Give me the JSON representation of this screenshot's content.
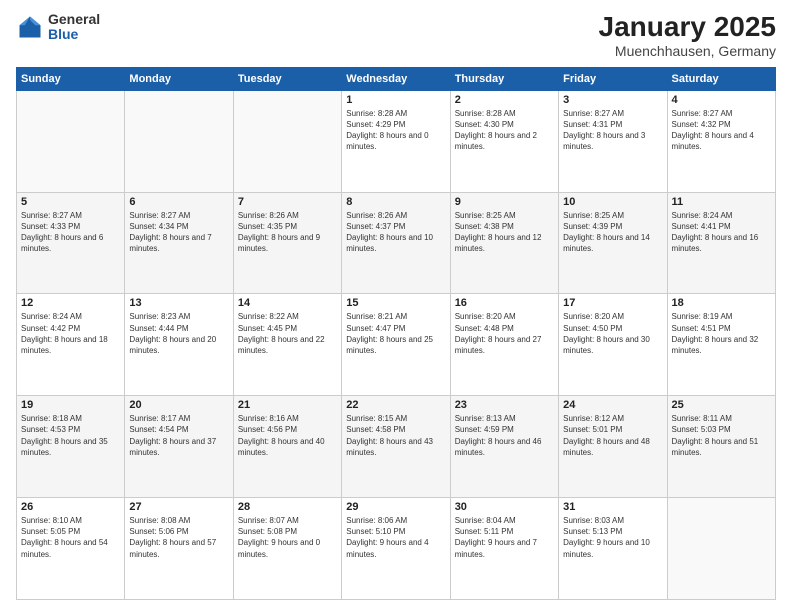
{
  "logo": {
    "general": "General",
    "blue": "Blue"
  },
  "title": "January 2025",
  "subtitle": "Muenchhausen, Germany",
  "days_of_week": [
    "Sunday",
    "Monday",
    "Tuesday",
    "Wednesday",
    "Thursday",
    "Friday",
    "Saturday"
  ],
  "weeks": [
    [
      {
        "day": "",
        "sunrise": "",
        "sunset": "",
        "daylight": ""
      },
      {
        "day": "",
        "sunrise": "",
        "sunset": "",
        "daylight": ""
      },
      {
        "day": "",
        "sunrise": "",
        "sunset": "",
        "daylight": ""
      },
      {
        "day": "1",
        "sunrise": "Sunrise: 8:28 AM",
        "sunset": "Sunset: 4:29 PM",
        "daylight": "Daylight: 8 hours and 0 minutes."
      },
      {
        "day": "2",
        "sunrise": "Sunrise: 8:28 AM",
        "sunset": "Sunset: 4:30 PM",
        "daylight": "Daylight: 8 hours and 2 minutes."
      },
      {
        "day": "3",
        "sunrise": "Sunrise: 8:27 AM",
        "sunset": "Sunset: 4:31 PM",
        "daylight": "Daylight: 8 hours and 3 minutes."
      },
      {
        "day": "4",
        "sunrise": "Sunrise: 8:27 AM",
        "sunset": "Sunset: 4:32 PM",
        "daylight": "Daylight: 8 hours and 4 minutes."
      }
    ],
    [
      {
        "day": "5",
        "sunrise": "Sunrise: 8:27 AM",
        "sunset": "Sunset: 4:33 PM",
        "daylight": "Daylight: 8 hours and 6 minutes."
      },
      {
        "day": "6",
        "sunrise": "Sunrise: 8:27 AM",
        "sunset": "Sunset: 4:34 PM",
        "daylight": "Daylight: 8 hours and 7 minutes."
      },
      {
        "day": "7",
        "sunrise": "Sunrise: 8:26 AM",
        "sunset": "Sunset: 4:35 PM",
        "daylight": "Daylight: 8 hours and 9 minutes."
      },
      {
        "day": "8",
        "sunrise": "Sunrise: 8:26 AM",
        "sunset": "Sunset: 4:37 PM",
        "daylight": "Daylight: 8 hours and 10 minutes."
      },
      {
        "day": "9",
        "sunrise": "Sunrise: 8:25 AM",
        "sunset": "Sunset: 4:38 PM",
        "daylight": "Daylight: 8 hours and 12 minutes."
      },
      {
        "day": "10",
        "sunrise": "Sunrise: 8:25 AM",
        "sunset": "Sunset: 4:39 PM",
        "daylight": "Daylight: 8 hours and 14 minutes."
      },
      {
        "day": "11",
        "sunrise": "Sunrise: 8:24 AM",
        "sunset": "Sunset: 4:41 PM",
        "daylight": "Daylight: 8 hours and 16 minutes."
      }
    ],
    [
      {
        "day": "12",
        "sunrise": "Sunrise: 8:24 AM",
        "sunset": "Sunset: 4:42 PM",
        "daylight": "Daylight: 8 hours and 18 minutes."
      },
      {
        "day": "13",
        "sunrise": "Sunrise: 8:23 AM",
        "sunset": "Sunset: 4:44 PM",
        "daylight": "Daylight: 8 hours and 20 minutes."
      },
      {
        "day": "14",
        "sunrise": "Sunrise: 8:22 AM",
        "sunset": "Sunset: 4:45 PM",
        "daylight": "Daylight: 8 hours and 22 minutes."
      },
      {
        "day": "15",
        "sunrise": "Sunrise: 8:21 AM",
        "sunset": "Sunset: 4:47 PM",
        "daylight": "Daylight: 8 hours and 25 minutes."
      },
      {
        "day": "16",
        "sunrise": "Sunrise: 8:20 AM",
        "sunset": "Sunset: 4:48 PM",
        "daylight": "Daylight: 8 hours and 27 minutes."
      },
      {
        "day": "17",
        "sunrise": "Sunrise: 8:20 AM",
        "sunset": "Sunset: 4:50 PM",
        "daylight": "Daylight: 8 hours and 30 minutes."
      },
      {
        "day": "18",
        "sunrise": "Sunrise: 8:19 AM",
        "sunset": "Sunset: 4:51 PM",
        "daylight": "Daylight: 8 hours and 32 minutes."
      }
    ],
    [
      {
        "day": "19",
        "sunrise": "Sunrise: 8:18 AM",
        "sunset": "Sunset: 4:53 PM",
        "daylight": "Daylight: 8 hours and 35 minutes."
      },
      {
        "day": "20",
        "sunrise": "Sunrise: 8:17 AM",
        "sunset": "Sunset: 4:54 PM",
        "daylight": "Daylight: 8 hours and 37 minutes."
      },
      {
        "day": "21",
        "sunrise": "Sunrise: 8:16 AM",
        "sunset": "Sunset: 4:56 PM",
        "daylight": "Daylight: 8 hours and 40 minutes."
      },
      {
        "day": "22",
        "sunrise": "Sunrise: 8:15 AM",
        "sunset": "Sunset: 4:58 PM",
        "daylight": "Daylight: 8 hours and 43 minutes."
      },
      {
        "day": "23",
        "sunrise": "Sunrise: 8:13 AM",
        "sunset": "Sunset: 4:59 PM",
        "daylight": "Daylight: 8 hours and 46 minutes."
      },
      {
        "day": "24",
        "sunrise": "Sunrise: 8:12 AM",
        "sunset": "Sunset: 5:01 PM",
        "daylight": "Daylight: 8 hours and 48 minutes."
      },
      {
        "day": "25",
        "sunrise": "Sunrise: 8:11 AM",
        "sunset": "Sunset: 5:03 PM",
        "daylight": "Daylight: 8 hours and 51 minutes."
      }
    ],
    [
      {
        "day": "26",
        "sunrise": "Sunrise: 8:10 AM",
        "sunset": "Sunset: 5:05 PM",
        "daylight": "Daylight: 8 hours and 54 minutes."
      },
      {
        "day": "27",
        "sunrise": "Sunrise: 8:08 AM",
        "sunset": "Sunset: 5:06 PM",
        "daylight": "Daylight: 8 hours and 57 minutes."
      },
      {
        "day": "28",
        "sunrise": "Sunrise: 8:07 AM",
        "sunset": "Sunset: 5:08 PM",
        "daylight": "Daylight: 9 hours and 0 minutes."
      },
      {
        "day": "29",
        "sunrise": "Sunrise: 8:06 AM",
        "sunset": "Sunset: 5:10 PM",
        "daylight": "Daylight: 9 hours and 4 minutes."
      },
      {
        "day": "30",
        "sunrise": "Sunrise: 8:04 AM",
        "sunset": "Sunset: 5:11 PM",
        "daylight": "Daylight: 9 hours and 7 minutes."
      },
      {
        "day": "31",
        "sunrise": "Sunrise: 8:03 AM",
        "sunset": "Sunset: 5:13 PM",
        "daylight": "Daylight: 9 hours and 10 minutes."
      },
      {
        "day": "",
        "sunrise": "",
        "sunset": "",
        "daylight": ""
      }
    ]
  ]
}
